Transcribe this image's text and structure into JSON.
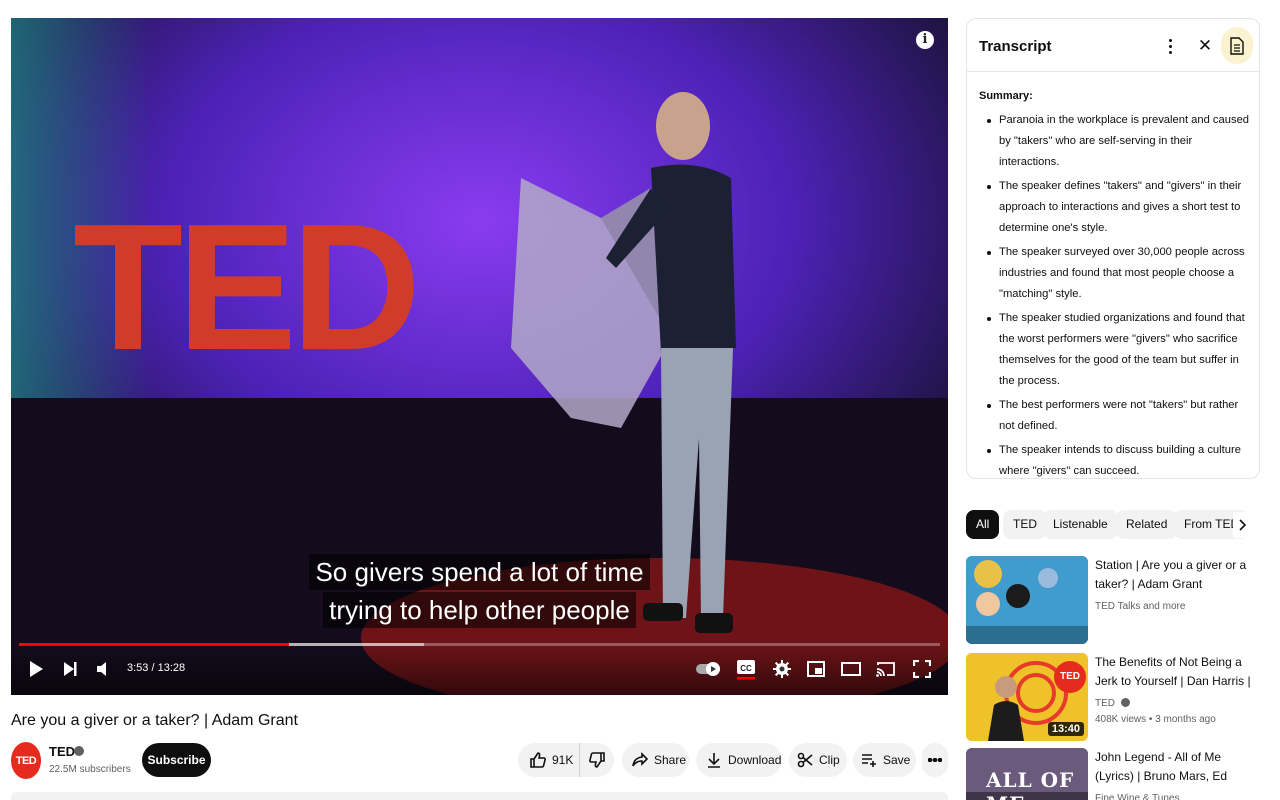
{
  "player": {
    "caption_lines": [
      "So givers spend a lot of time",
      "trying to help other people"
    ],
    "time_display": "3:53 / 13:28",
    "progress_fraction": 0.293,
    "buffer_fraction": 0.44,
    "stage_logo_text": "TED"
  },
  "video": {
    "title": "Are you a giver or a taker? | Adam Grant",
    "channel_name": "TED",
    "subscribers": "22.5M subscribers",
    "subscribe_label": "Subscribe",
    "avatar_text": "TED",
    "likes": "91K",
    "share_label": "Share",
    "download_label": "Download",
    "clip_label": "Clip",
    "save_label": "Save"
  },
  "transcript": {
    "title": "Transcript",
    "summary_heading": "Summary:",
    "summary_points": [
      "Paranoia in the workplace is prevalent and caused by \"takers\" who are self-serving in their interactions.",
      "The speaker defines \"takers\" and \"givers\" in their approach to interactions and gives a short test to determine one's style.",
      "The speaker surveyed over 30,000 people across industries and found that most people choose a \"matching\" style.",
      "The speaker studied organizations and found that the worst performers were \"givers\" who sacrifice themselves for the good of the team but suffer in the process.",
      "The best performers were not \"takers\" but rather not defined.",
      "The speaker intends to discuss building a culture where \"givers\" can succeed."
    ]
  },
  "chips": [
    "All",
    "TED",
    "Listenable",
    "Related",
    "From TED"
  ],
  "related": [
    {
      "title": "Station | Are you a giver or a taker? | Adam Grant",
      "channel": "TED Talks and more",
      "meta": "",
      "duration": ""
    },
    {
      "title": "The Benefits of Not Being a Jerk to Yourself | Dan Harris | …",
      "channel": "TED",
      "meta": "408K views • 3 months ago",
      "duration": "13:40",
      "badge_text": "TED"
    },
    {
      "title": "John Legend - All of Me (Lyrics) | Bruno Mars, Ed Sheeran, Clea…",
      "channel": "Fine Wine & Tunes",
      "meta": "",
      "duration": "",
      "thumb_text": "ALL OF ME"
    }
  ],
  "colors": {
    "brand_red": "#e62b1e",
    "progress_red": "#ff0000",
    "stage_purple": "#6a2fd8"
  }
}
